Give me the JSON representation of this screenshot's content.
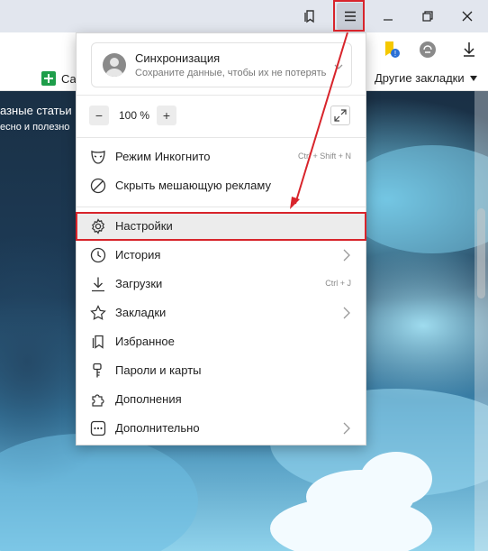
{
  "colors": {
    "accent_red": "#d8242b",
    "menu_bg": "#ffffff",
    "highlight_bg": "#ececec",
    "titlebar_bg": "#e2e6ee"
  },
  "titlebar": {
    "icons": [
      "bookmarks-icon",
      "menu-icon",
      "minimize-icon",
      "maximize-icon",
      "close-icon"
    ]
  },
  "bookmarks_bar": {
    "sites_label": "Сайты",
    "other_label": "Другие закладки"
  },
  "page": {
    "title_fragment": "азные статьи",
    "subtitle_fragment": "есно и полезно"
  },
  "menu": {
    "sync": {
      "title": "Синхронизация",
      "subtitle": "Сохраните данные, чтобы их не потерять"
    },
    "zoom": {
      "minus": "−",
      "level": "100 %",
      "plus": "+"
    },
    "items": [
      {
        "label": "Режим Инкогнито",
        "shortcut": "Ctrl + Shift + N",
        "icon": "incognito-mask-icon"
      },
      {
        "label": "Скрыть мешающую рекламу",
        "shortcut": "",
        "icon": "block-ads-icon"
      },
      {
        "label": "Настройки",
        "shortcut": "",
        "icon": "gear-icon",
        "highlighted": true
      },
      {
        "label": "История",
        "shortcut": "",
        "icon": "clock-icon",
        "submenu": true
      },
      {
        "label": "Загрузки",
        "shortcut": "Ctrl + J",
        "icon": "download-icon"
      },
      {
        "label": "Закладки",
        "shortcut": "",
        "icon": "star-icon",
        "submenu": true
      },
      {
        "label": "Избранное",
        "shortcut": "",
        "icon": "collections-icon"
      },
      {
        "label": "Пароли и карты",
        "shortcut": "",
        "icon": "key-icon"
      },
      {
        "label": "Дополнения",
        "shortcut": "",
        "icon": "puzzle-icon"
      },
      {
        "label": "Дополнительно",
        "shortcut": "",
        "icon": "more-dots-icon",
        "submenu": true
      }
    ]
  }
}
